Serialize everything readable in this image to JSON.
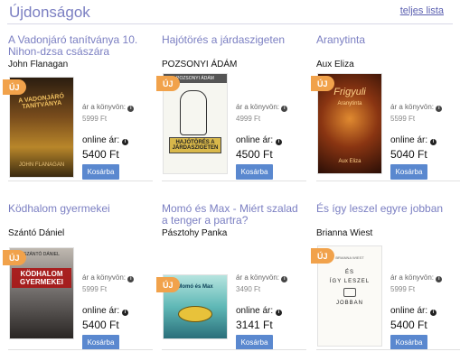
{
  "section": {
    "title": "Újdonságok",
    "all_link": "teljes lista"
  },
  "labels": {
    "badge": "ÚJ",
    "book_price": "ár a könyvön:",
    "online_price": "online ár:",
    "cart_button": "Kosárba"
  },
  "books": [
    {
      "title": "A Vadonjáró tanítványa 10. Nihon-dzsa császára",
      "author": "John Flanagan",
      "book_price": "5999 Ft",
      "online_price": "5400 Ft",
      "cover_text": "A VADONJÁRÓ TANÍTVÁNYA",
      "cover_author": "JOHN FLANAGAN"
    },
    {
      "title": "Hajótörés a járdaszigeten",
      "author": "POZSONYI ÁDÁM",
      "book_price": "4999 Ft",
      "online_price": "4500 Ft",
      "cover_text": "HAJÓTÖRÉS A JÁRDASZIGETEN",
      "cover_author": "POZSONYI ÁDÁM"
    },
    {
      "title": "Aranytinta",
      "author": "Aux Eliza",
      "book_price": "5599 Ft",
      "online_price": "5040 Ft",
      "cover_text": "Frigyuli",
      "cover_sub": "Aranytinta",
      "cover_author": "Aux Eliza"
    },
    {
      "title": "Ködhalom gyermekei",
      "author": "Szántó Dániel",
      "book_price": "5999 Ft",
      "online_price": "5400 Ft",
      "cover_text": "KÖDHALOM GYERMEKEI",
      "cover_author": "SZÁNTÓ DÁNIEL"
    },
    {
      "title": "Momó és Max - Miért szalad a tenger a partra?",
      "author": "Pásztohy Panka",
      "book_price": "3490 Ft",
      "online_price": "3141 Ft",
      "cover_text": "Momó és Max"
    },
    {
      "title": "És így leszel egyre jobban",
      "author": "Brianna Wiest",
      "book_price": "5999 Ft",
      "online_price": "5400 Ft",
      "cover_line1": "ÉS",
      "cover_line2": "ÍGY LESZEL",
      "cover_line3": "JOBBAN",
      "cover_pin": "EGYRE",
      "cover_author": "BRIANNA WIEST"
    }
  ],
  "colors": {
    "accent": "#7b7fc2",
    "badge": "#f1a24b",
    "button": "#5a88cf"
  },
  "icons": {
    "info": "info-icon"
  }
}
